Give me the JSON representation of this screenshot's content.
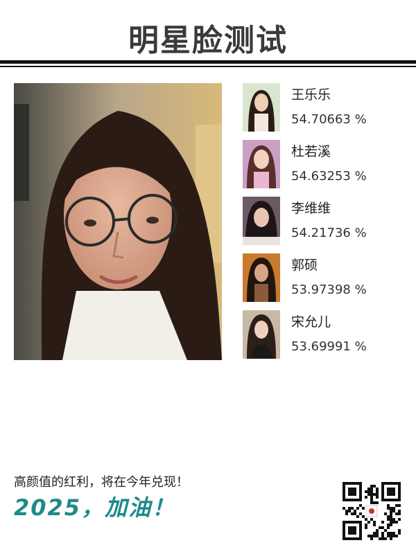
{
  "header": {
    "title": "明星脸测试"
  },
  "user_photo": {
    "icon": "user-selfie-photo"
  },
  "matches": [
    {
      "name": "王乐乐",
      "score": "54.70663 %",
      "icon": "celebrity-avatar"
    },
    {
      "name": "杜若溪",
      "score": "54.63253 %",
      "icon": "celebrity-avatar"
    },
    {
      "name": "李维维",
      "score": "54.21736 %",
      "icon": "celebrity-avatar"
    },
    {
      "name": "郭硕",
      "score": "53.97398 %",
      "icon": "celebrity-avatar"
    },
    {
      "name": "宋允儿",
      "score": "53.69991 %",
      "icon": "celebrity-avatar"
    }
  ],
  "footer": {
    "tagline": "高颜值的红利，将在今年兑现！",
    "slogan": "2025，加油！",
    "qr_icon": "qr-code-icon"
  },
  "colors": {
    "title": "#3a3a3a",
    "rule": "#111111",
    "slogan": "#1f8a8a",
    "background": "#ffffff"
  }
}
